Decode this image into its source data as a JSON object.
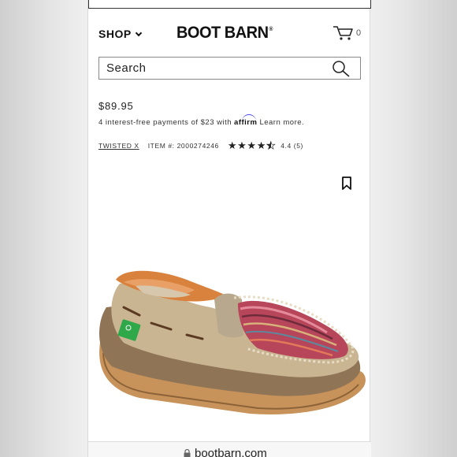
{
  "header": {
    "shop_label": "SHOP",
    "logo_text": "BOOT BARN",
    "logo_mark": "®",
    "cart_count": "0",
    "cart_icon": "cart-icon",
    "shop_icon": "chevron-down-icon"
  },
  "search": {
    "placeholder": "Search",
    "icon": "search-icon"
  },
  "product": {
    "price": "$89.95",
    "installments_prefix": "4 interest-free payments of $23 with",
    "affirm_label": "affirm",
    "learn_more": "Learn more.",
    "brand": "TWISTED X",
    "item_number": "ITEM #: 2000274246",
    "rating_text": "4.4 (5)",
    "rating_value": 4.4,
    "rating_max": 5,
    "bookmark_icon": "bookmark-icon",
    "image_description": "shoe-image"
  },
  "browser": {
    "url": "bootbarn.com",
    "lock_icon": "lock-icon"
  },
  "colors": {
    "text": "#222222",
    "affirm_accent": "#4a4af4",
    "shoe_tan": "#b09a79",
    "shoe_orange": "#d9823e"
  }
}
